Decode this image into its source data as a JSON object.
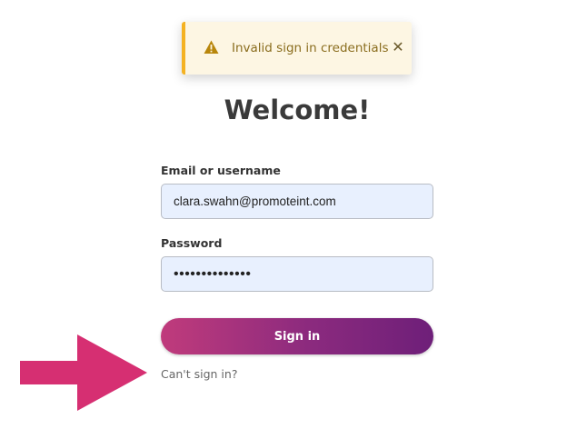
{
  "toast": {
    "icon": "warning-icon",
    "message": "Invalid sign in credentials",
    "close_icon": "close-icon",
    "close_glyph": "✕",
    "accent_color": "#f4b223",
    "background_color": "#fdf6e3"
  },
  "page": {
    "title": "Welcome!"
  },
  "form": {
    "email_label": "Email or username",
    "email_value": "clara.swahn@promoteint.com",
    "password_label": "Password",
    "password_value": "••••••••••••••",
    "signin_label": "Sign in",
    "cant_signin_label": "Can't sign in?",
    "button_gradient": [
      "#c03b7c",
      "#6e1f79"
    ]
  },
  "annotation": {
    "icon": "arrow-right-icon",
    "color": "#d62f72"
  }
}
